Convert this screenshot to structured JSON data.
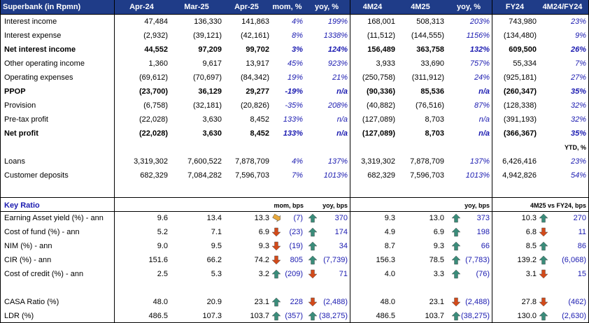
{
  "header": {
    "title": "Superbank (in Rpmn)",
    "cols": [
      "Apr-24",
      "Mar-25",
      "Apr-25",
      "mom, %",
      "yoy, %",
      "4M24",
      "4M25",
      "yoy, %",
      "FY24",
      "4M24/FY24"
    ]
  },
  "rows": [
    {
      "label": "Interest income",
      "bold": false,
      "vals": [
        "47,484",
        "136,330",
        "141,863",
        "4%",
        "199%",
        "168,001",
        "508,313",
        "203%",
        "743,980",
        "23%"
      ]
    },
    {
      "label": "Interest expense",
      "bold": false,
      "vals": [
        "(2,932)",
        "(39,121)",
        "(42,161)",
        "8%",
        "1338%",
        "(11,512)",
        "(144,555)",
        "1156%",
        "(134,480)",
        "9%"
      ]
    },
    {
      "label": "Net interest income",
      "bold": true,
      "vals": [
        "44,552",
        "97,209",
        "99,702",
        "3%",
        "124%",
        "156,489",
        "363,758",
        "132%",
        "609,500",
        "26%"
      ]
    },
    {
      "label": "Other operating income",
      "bold": false,
      "vals": [
        "1,360",
        "9,617",
        "13,917",
        "45%",
        "923%",
        "3,933",
        "33,690",
        "757%",
        "55,334",
        "7%"
      ]
    },
    {
      "label": "Operating expenses",
      "bold": false,
      "vals": [
        "(69,612)",
        "(70,697)",
        "(84,342)",
        "19%",
        "21%",
        "(250,758)",
        "(311,912)",
        "24%",
        "(925,181)",
        "27%"
      ]
    },
    {
      "label": "PPOP",
      "bold": true,
      "vals": [
        "(23,700)",
        "36,129",
        "29,277",
        "-19%",
        "n/a",
        "(90,336)",
        "85,536",
        "n/a",
        "(260,347)",
        "35%"
      ]
    },
    {
      "label": "Provision",
      "bold": false,
      "vals": [
        "(6,758)",
        "(32,181)",
        "(20,826)",
        "-35%",
        "208%",
        "(40,882)",
        "(76,516)",
        "87%",
        "(128,338)",
        "32%"
      ]
    },
    {
      "label": "Pre-tax profit",
      "bold": false,
      "vals": [
        "(22,028)",
        "3,630",
        "8,452",
        "133%",
        "n/a",
        "(127,089)",
        "8,703",
        "n/a",
        "(391,193)",
        "32%"
      ]
    },
    {
      "label": "Net profit",
      "bold": true,
      "vals": [
        "(22,028)",
        "3,630",
        "8,452",
        "133%",
        "n/a",
        "(127,089)",
        "8,703",
        "n/a",
        "(366,367)",
        "35%"
      ]
    }
  ],
  "ytd_label": "YTD, %",
  "balance_rows": [
    {
      "label": "Loans",
      "vals": [
        "3,319,302",
        "7,600,522",
        "7,878,709",
        "4%",
        "137%",
        "3,319,302",
        "7,878,709",
        "137%",
        "6,426,416",
        "23%"
      ]
    },
    {
      "label": "Customer deposits",
      "vals": [
        "682,329",
        "7,084,282",
        "7,596,703",
        "7%",
        "1013%",
        "682,329",
        "7,596,703",
        "1013%",
        "4,942,826",
        "54%"
      ]
    }
  ],
  "key_ratio": {
    "title": "Key Ratio",
    "col_mom": "mom, bps",
    "col_yoy": "yoy, bps",
    "col_yoy2": "yoy, bps",
    "col_fy": "4M25 vs FY24, bps",
    "rows": [
      {
        "label": "Earning Asset yield (%) - ann",
        "vals": [
          "9.6",
          "13.4",
          "13.3",
          "(7)",
          "370",
          "9.3",
          "13.0",
          "373",
          "10.3",
          "270"
        ],
        "arrows": [
          "side",
          "up",
          "",
          "up",
          "",
          "up"
        ]
      },
      {
        "label": "Cost of fund (%) - ann",
        "vals": [
          "5.2",
          "7.1",
          "6.9",
          "(23)",
          "174",
          "4.9",
          "6.9",
          "198",
          "6.8",
          "11"
        ],
        "arrows": [
          "down",
          "up",
          "",
          "up",
          "",
          "down"
        ]
      },
      {
        "label": "NIM (%) - ann",
        "vals": [
          "9.0",
          "9.5",
          "9.3",
          "(19)",
          "34",
          "8.7",
          "9.3",
          "66",
          "8.5",
          "86"
        ],
        "arrows": [
          "down",
          "up",
          "",
          "up",
          "",
          "up"
        ]
      },
      {
        "label": "CIR (%) - ann",
        "vals": [
          "151.6",
          "66.2",
          "74.2",
          "805",
          "(7,739)",
          "156.3",
          "78.5",
          "(7,783)",
          "139.2",
          "(6,068)"
        ],
        "arrows": [
          "down",
          "up",
          "",
          "up",
          "",
          "up"
        ]
      },
      {
        "label": "Cost of credit (%) - ann",
        "vals": [
          "2.5",
          "5.3",
          "3.2",
          "(209)",
          "71",
          "4.0",
          "3.3",
          "(76)",
          "3.1",
          "15"
        ],
        "arrows": [
          "up",
          "down",
          "",
          "up",
          "",
          "down"
        ]
      }
    ],
    "rows2": [
      {
        "label": "CASA Ratio (%)",
        "vals": [
          "48.0",
          "20.9",
          "23.1",
          "228",
          "(2,488)",
          "48.0",
          "23.1",
          "(2,488)",
          "27.8",
          "(462)"
        ],
        "arrows": [
          "up",
          "down",
          "",
          "down",
          "",
          "down"
        ]
      },
      {
        "label": "LDR (%)",
        "vals": [
          "486.5",
          "107.3",
          "103.7",
          "(357)",
          "(38,275)",
          "486.5",
          "103.7",
          "(38,275)",
          "130.0",
          "(2,630)"
        ],
        "arrows": [
          "up",
          "up",
          "",
          "up",
          "",
          "up"
        ]
      }
    ]
  },
  "colors": {
    "header_bg": "#1f3c88",
    "blue_text": "#1a1ab0",
    "arrow_up": "#3a8c7a",
    "arrow_down": "#d24a1a",
    "arrow_side": "#e8a93c"
  }
}
